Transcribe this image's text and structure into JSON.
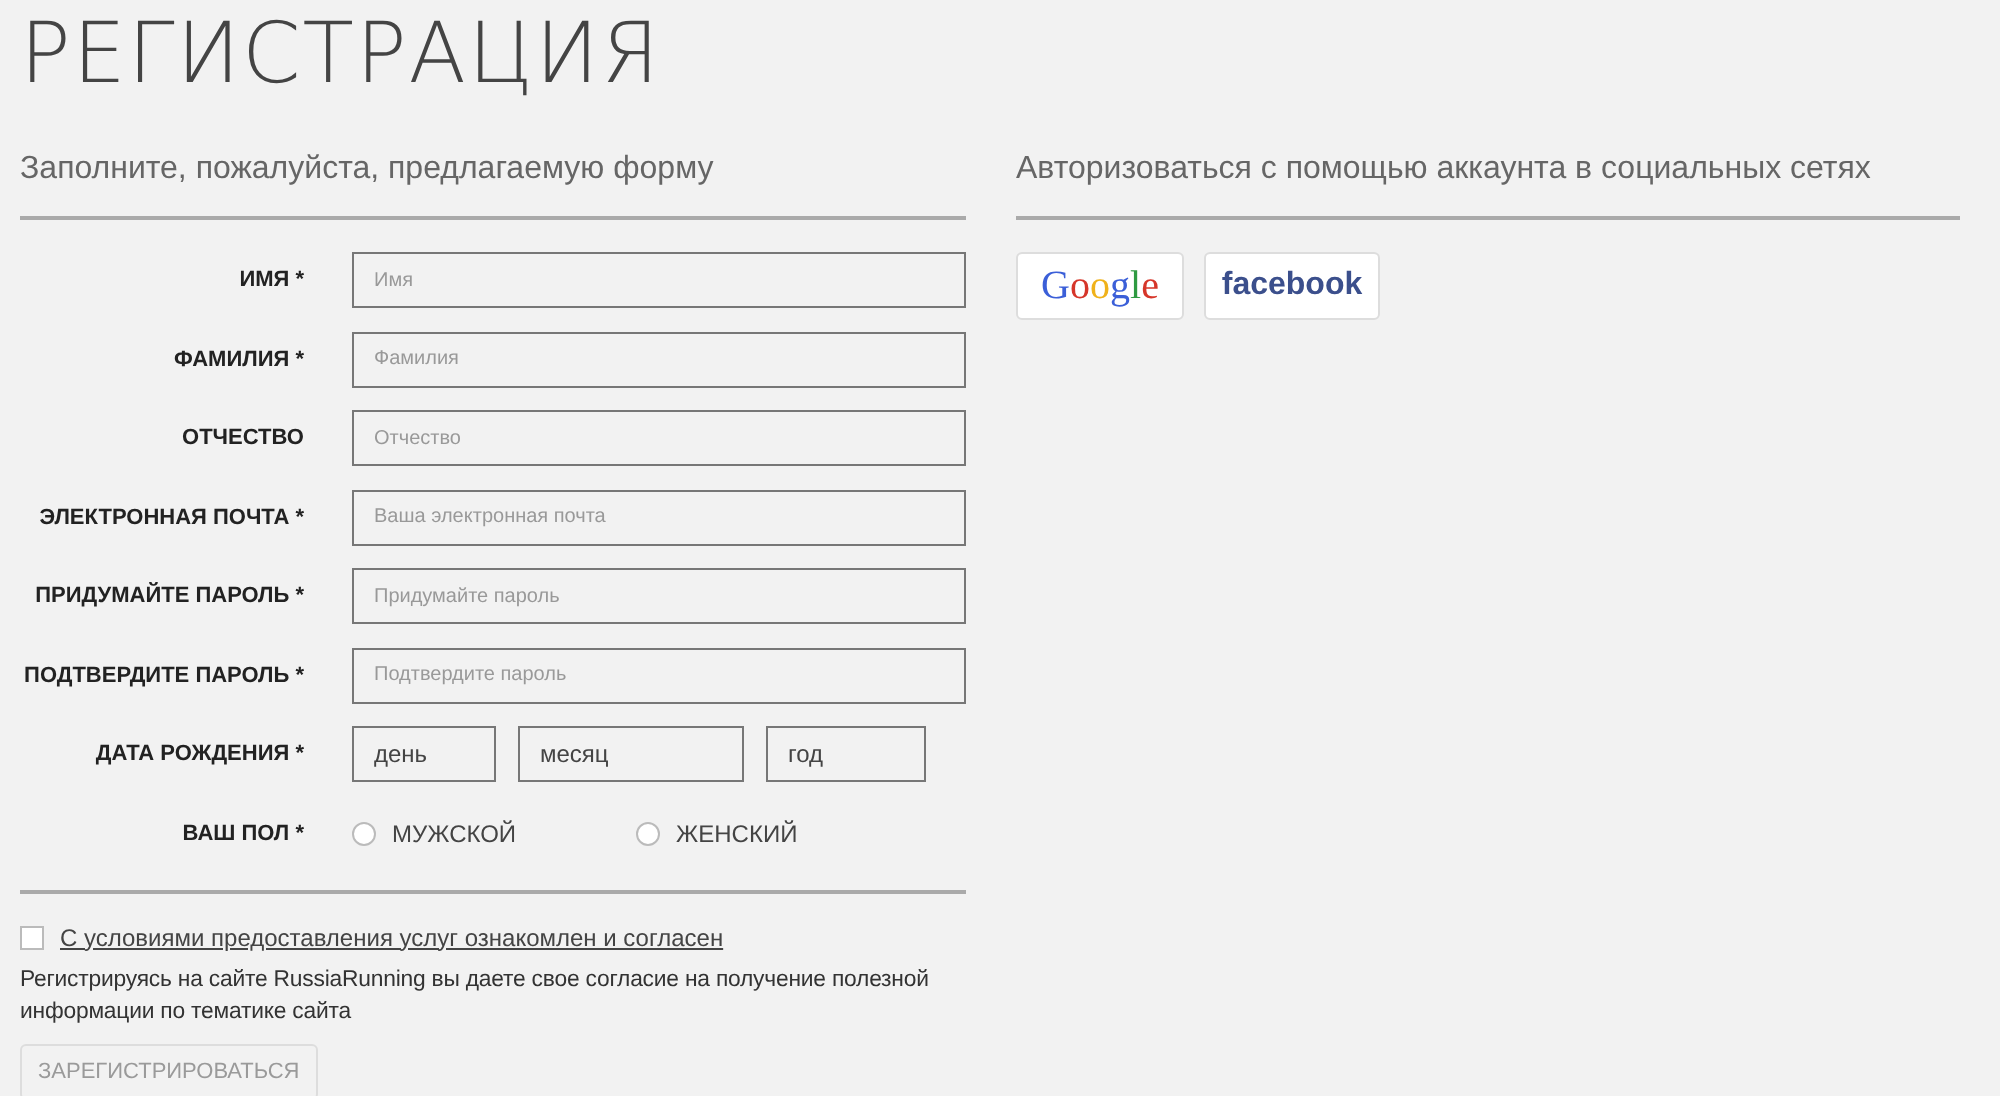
{
  "title": "РЕГИСТРАЦИЯ",
  "form": {
    "heading": "Заполните, пожалуйста, предлагаемую форму",
    "rows": [
      {
        "kind": "text",
        "label": "ИМЯ *",
        "placeholder": "Имя"
      },
      {
        "kind": "text",
        "label": "ФАМИЛИЯ *",
        "placeholder": "Фамилия"
      },
      {
        "kind": "text",
        "label": "ОТЧЕСТВО",
        "placeholder": "Отчество"
      },
      {
        "kind": "text",
        "label": "ЭЛЕКТРОННАЯ ПОЧТА *",
        "placeholder": "Ваша электронная почта"
      },
      {
        "kind": "text",
        "label": "ПРИДУМАЙТЕ ПАРОЛЬ *",
        "placeholder": "Придумайте пароль"
      },
      {
        "kind": "text",
        "label": "ПОДТВЕРДИТЕ ПАРОЛЬ *",
        "placeholder": "Подтвердите пароль"
      },
      {
        "kind": "date",
        "label": "ДАТА РОЖДЕНИЯ *",
        "parts": [
          "день",
          "месяц",
          "год"
        ]
      },
      {
        "kind": "radio",
        "label": "ВАШ ПОЛ *",
        "options": [
          {
            "label": "МУЖСКОЙ",
            "selected": false
          },
          {
            "label": "ЖЕНСКИЙ",
            "selected": false
          }
        ]
      }
    ],
    "terms": {
      "label": "С условиями предоставления услуг ознакомлен и согласен",
      "checked": false
    },
    "consent": "Регистрируясь на сайте RussiaRunning вы даете свое согласие на получение полезной информации по тематике сайта",
    "submit": {
      "label": "ЗАРЕГИСТРИРОВАТЬСЯ",
      "disabled": true
    }
  },
  "social": {
    "heading": "Авторизоваться с помощью аккаунта в социальных сетях",
    "buttons": [
      {
        "kind": "google",
        "label": "Google"
      },
      {
        "kind": "facebook",
        "label": "facebook"
      }
    ]
  }
}
